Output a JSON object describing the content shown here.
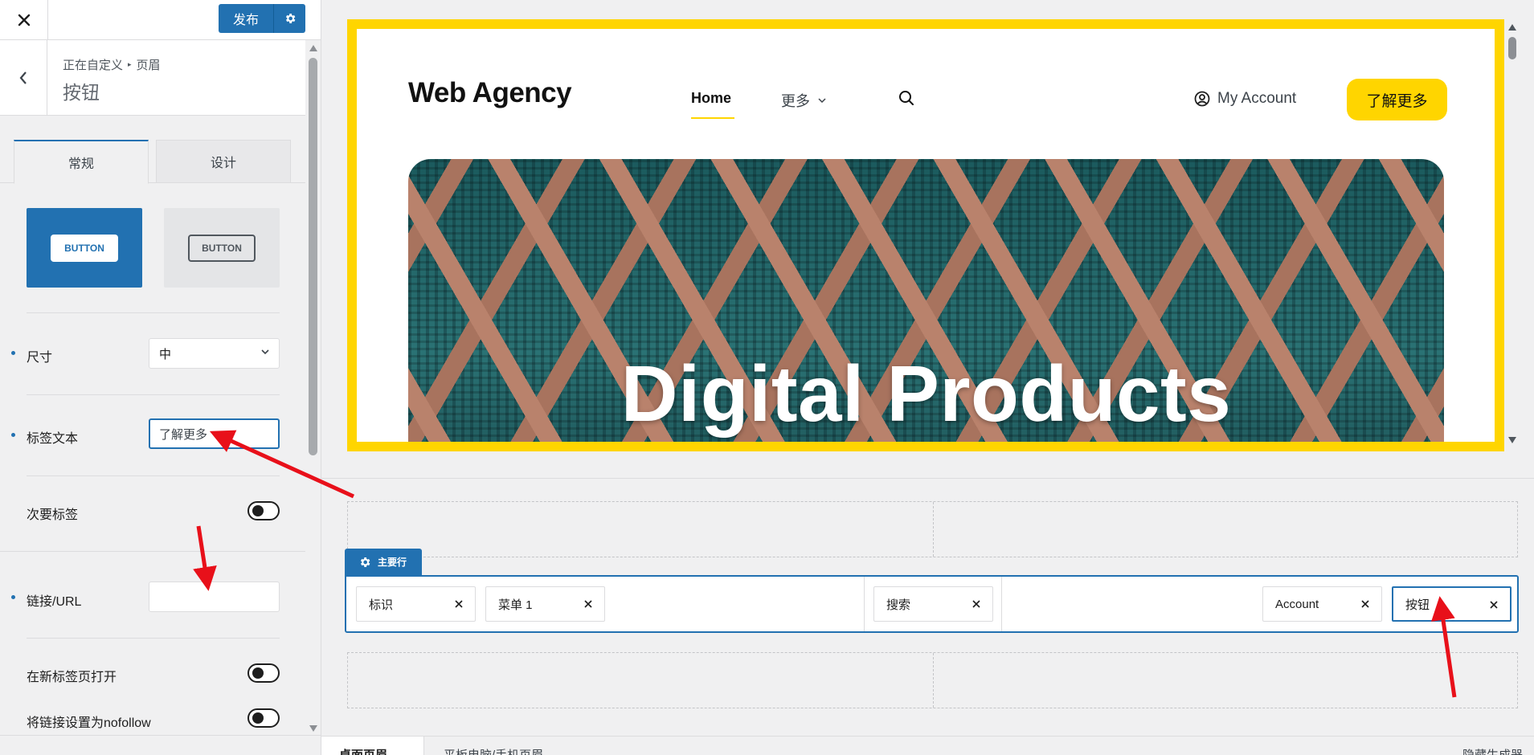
{
  "topbar": {
    "close_label": "关闭",
    "publish_label": "发布"
  },
  "section": {
    "breadcrumb_root": "正在自定义",
    "breadcrumb_parent": "页眉",
    "title": "按钮"
  },
  "tabs": [
    {
      "label": "常规",
      "active": true
    },
    {
      "label": "设计",
      "active": false
    }
  ],
  "styles": [
    {
      "label": "BUTTON",
      "variant": "filled",
      "selected": true
    },
    {
      "label": "BUTTON",
      "variant": "outline",
      "selected": false
    }
  ],
  "fields": {
    "size_label": "尺寸",
    "size_value": "中",
    "label_text_label": "标签文本",
    "label_text_value": "了解更多",
    "secondary_label": "次要标签",
    "url_label": "链接/URL",
    "url_value": "",
    "new_tab_label": "在新标签页打开",
    "nofollow_label": "将链接设置为nofollow"
  },
  "preview": {
    "logo": "Web Agency",
    "nav_home": "Home",
    "nav_more": "更多",
    "account": "My Account",
    "cta": "了解更多",
    "hero_title": "Digital Products",
    "accent_color": "#ffd500"
  },
  "builder": {
    "main_row_label": "主要行",
    "chips": [
      {
        "label": "标识"
      },
      {
        "label": "菜单 1"
      },
      {
        "label": "搜索"
      },
      {
        "label": "Account"
      },
      {
        "label": "按钮",
        "selected": true
      }
    ],
    "primary_color": "#2271b1"
  },
  "bottom": {
    "desktop_tab": "桌面页眉",
    "mobile_tab": "平板电脑/手机页眉",
    "hide_builder": "隐藏生成器"
  }
}
